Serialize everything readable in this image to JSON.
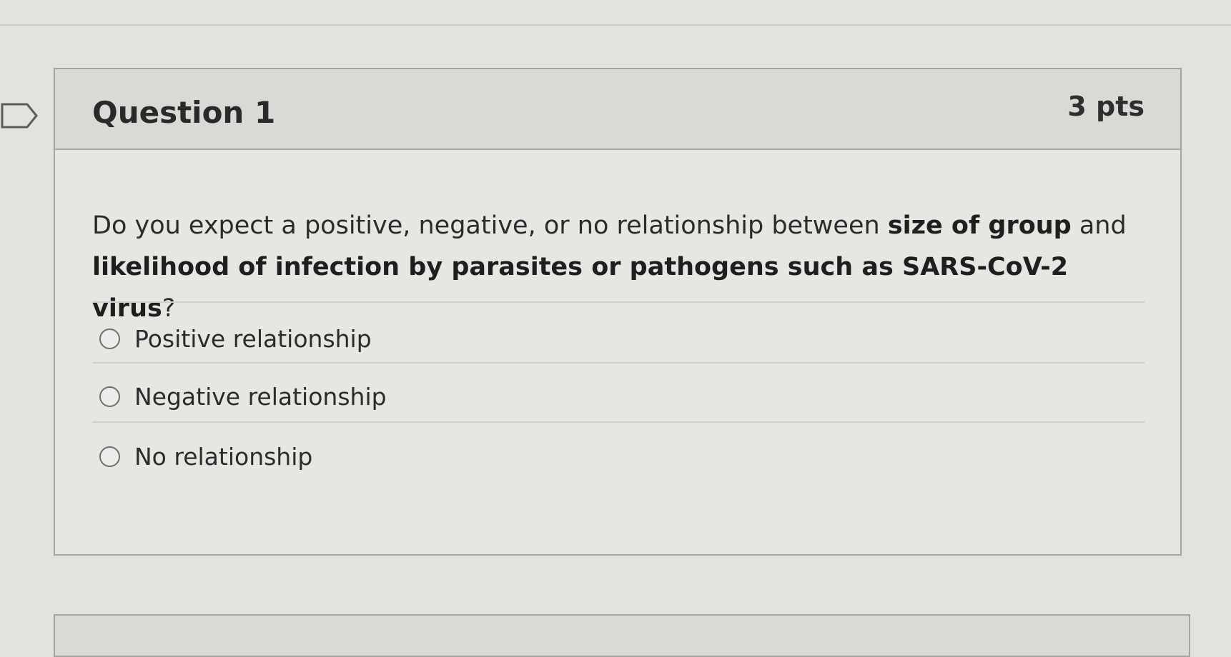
{
  "question": {
    "title": "Question 1",
    "points": "3 pts",
    "text_parts": [
      "Do you expect a positive, negative, or no relationship between ",
      "size of group",
      " and ",
      "likelihood of infection by parasites or pathogens such as SARS-CoV-2 virus",
      "?"
    ]
  },
  "answers": [
    {
      "label": "Positive relationship",
      "selected": false
    },
    {
      "label": "Negative relationship",
      "selected": false
    },
    {
      "label": "No relationship",
      "selected": false
    }
  ],
  "icons": {
    "flag": "flag-outline-icon",
    "radio": "radio-unselected-icon"
  },
  "colors": {
    "background": "#e2e3df",
    "header_background": "#d9dad6",
    "border": "#a3a5a1",
    "text": "#2b2b2b"
  }
}
